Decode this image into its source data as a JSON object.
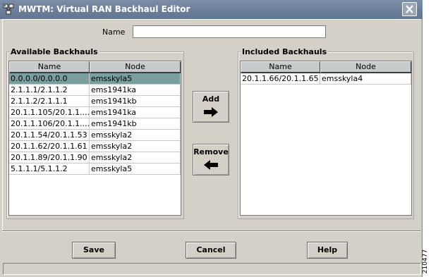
{
  "window": {
    "title": "MWTM: Virtual RAN Backhaul Editor"
  },
  "name_field": {
    "label": "Name",
    "value": ""
  },
  "available": {
    "title": "Available Backhauls",
    "columns": [
      "Name",
      "Node"
    ],
    "rows": [
      [
        "0.0.0.0/0.0.0.0",
        "emsskyla5"
      ],
      [
        "2.1.1.1/2.1.1.2",
        "ems1941ka"
      ],
      [
        "2.1.1.2/2.1.1.1",
        "ems1941kb"
      ],
      [
        "20.1.1.105/20.1.1....",
        "ems1941ka"
      ],
      [
        "20.1.1.106/20.1.1....",
        "ems1941kb"
      ],
      [
        "20.1.1.54/20.1.1.53",
        "emsskyla2"
      ],
      [
        "20.1.1.62/20.1.1.61",
        "emsskyla2"
      ],
      [
        "20.1.1.89/20.1.1.90",
        "emsskyla2"
      ],
      [
        "5.1.1.1/5.1.1.2",
        "emsskyla5"
      ]
    ],
    "selected_index": 0
  },
  "included": {
    "title": "Included Backhauls",
    "columns": [
      "Name",
      "Node"
    ],
    "rows": [
      [
        "20.1.1.66/20.1.1.65",
        "emsskyla4"
      ]
    ]
  },
  "actions": {
    "add_label": "Add",
    "remove_label": "Remove"
  },
  "buttons": {
    "save": "Save",
    "cancel": "Cancel",
    "help": "Help"
  },
  "figure_id": "210477",
  "colors": {
    "titlebar": "#6c7f9a",
    "selection": "#7a9ea0",
    "panel": "#d4d0c8"
  }
}
